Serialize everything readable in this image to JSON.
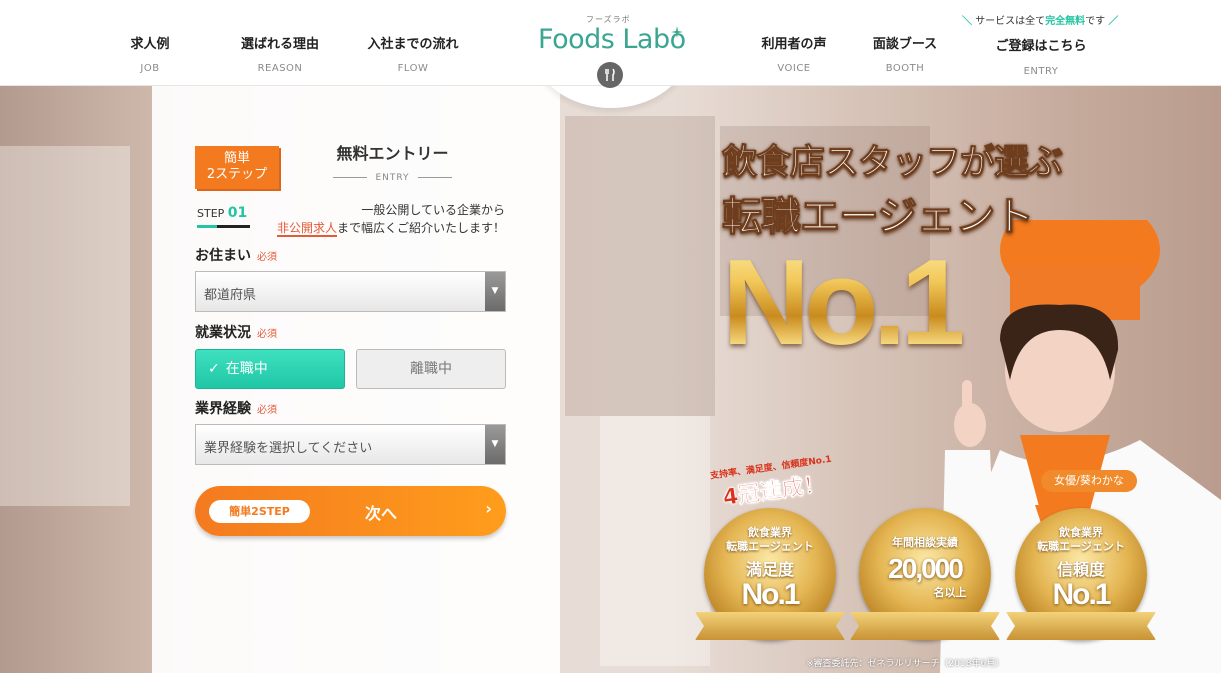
{
  "header": {
    "nav": [
      {
        "jp": "求人例",
        "en": "JOB"
      },
      {
        "jp": "選ばれる理由",
        "en": "REASON"
      },
      {
        "jp": "入社までの流れ",
        "en": "FLOW"
      },
      {
        "jp": "利用者の声",
        "en": "VOICE"
      },
      {
        "jp": "面談ブース",
        "en": "BOOTH"
      }
    ],
    "logo_text": "Foods Labo",
    "logo_kana": "フーズラボ",
    "free_note_pre": "サービスは全て",
    "free_note_hl": "完全無料",
    "free_note_post": "です",
    "entry_jp": "ご登録はこちら",
    "entry_en": "ENTRY"
  },
  "form": {
    "easy_tag_line1": "簡単",
    "easy_tag_line2": "2ステップ",
    "title": "無料エントリー",
    "subtitle": "ENTRY",
    "step_label": "STEP",
    "step_num": "01",
    "lead_line1": "一般公開している企業から",
    "lead_hl": "非公開求人",
    "lead_line2": "まで幅広くご紹介いたします！",
    "residence_label": "お住まい",
    "required": "必須",
    "residence_placeholder": "都道府県",
    "employment_label": "就業状況",
    "employment_options": [
      "在職中",
      "離職中"
    ],
    "employment_selected": "在職中",
    "experience_label": "業界経験",
    "experience_placeholder": "業界経験を選択してください",
    "next_pill": "簡単2STEP",
    "next_label": "次へ"
  },
  "hero": {
    "headline1": "飲食店スタッフが選ぶ",
    "headline2": "転職エージェント",
    "no1": "No.1",
    "crown_small": "支持率、満足度、信頼度No.1",
    "crown_big": "4冠達成！",
    "actress": "女優/葵わかな",
    "medals": [
      {
        "l1": "飲食業界",
        "l2": "転職エージェント",
        "big1": "満足度",
        "big2": "No.1"
      },
      {
        "l1": "",
        "l2": "年間相談実績",
        "big1": "20,000",
        "big2": "名以上"
      },
      {
        "l1": "飲食業界",
        "l2": "転職エージェント",
        "big1": "信頼度",
        "big2": "No.1"
      }
    ],
    "footnote": "※審査委託先：ゼネラルリサーチ（2018年6月）"
  },
  "colors": {
    "accent": "#f47a1f",
    "teal": "#22c4a2",
    "red": "#e35b39"
  }
}
